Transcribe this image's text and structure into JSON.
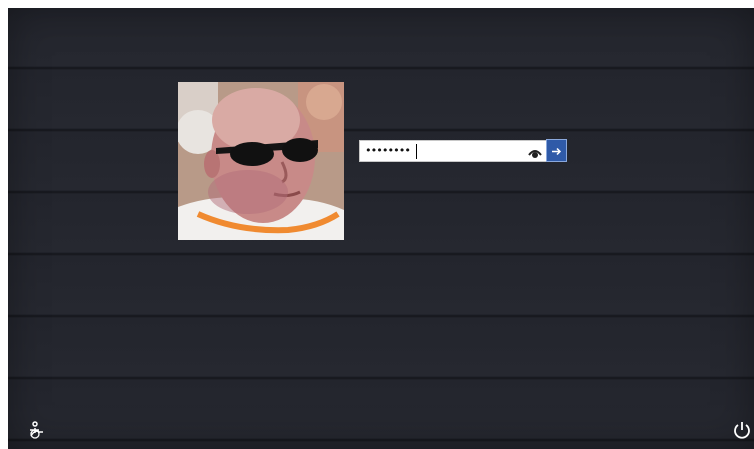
{
  "login": {
    "password_masked": "••••••••",
    "avatar_icon": "user-photo",
    "reveal_icon": "eye-icon",
    "submit_icon": "arrow-right-icon"
  },
  "footer": {
    "left_icon": "ease-of-access-icon",
    "right_icon": "power-icon"
  },
  "colors": {
    "background": "#23252d",
    "submit_button": "#2f5aa8",
    "icon_white": "#ffffff"
  }
}
